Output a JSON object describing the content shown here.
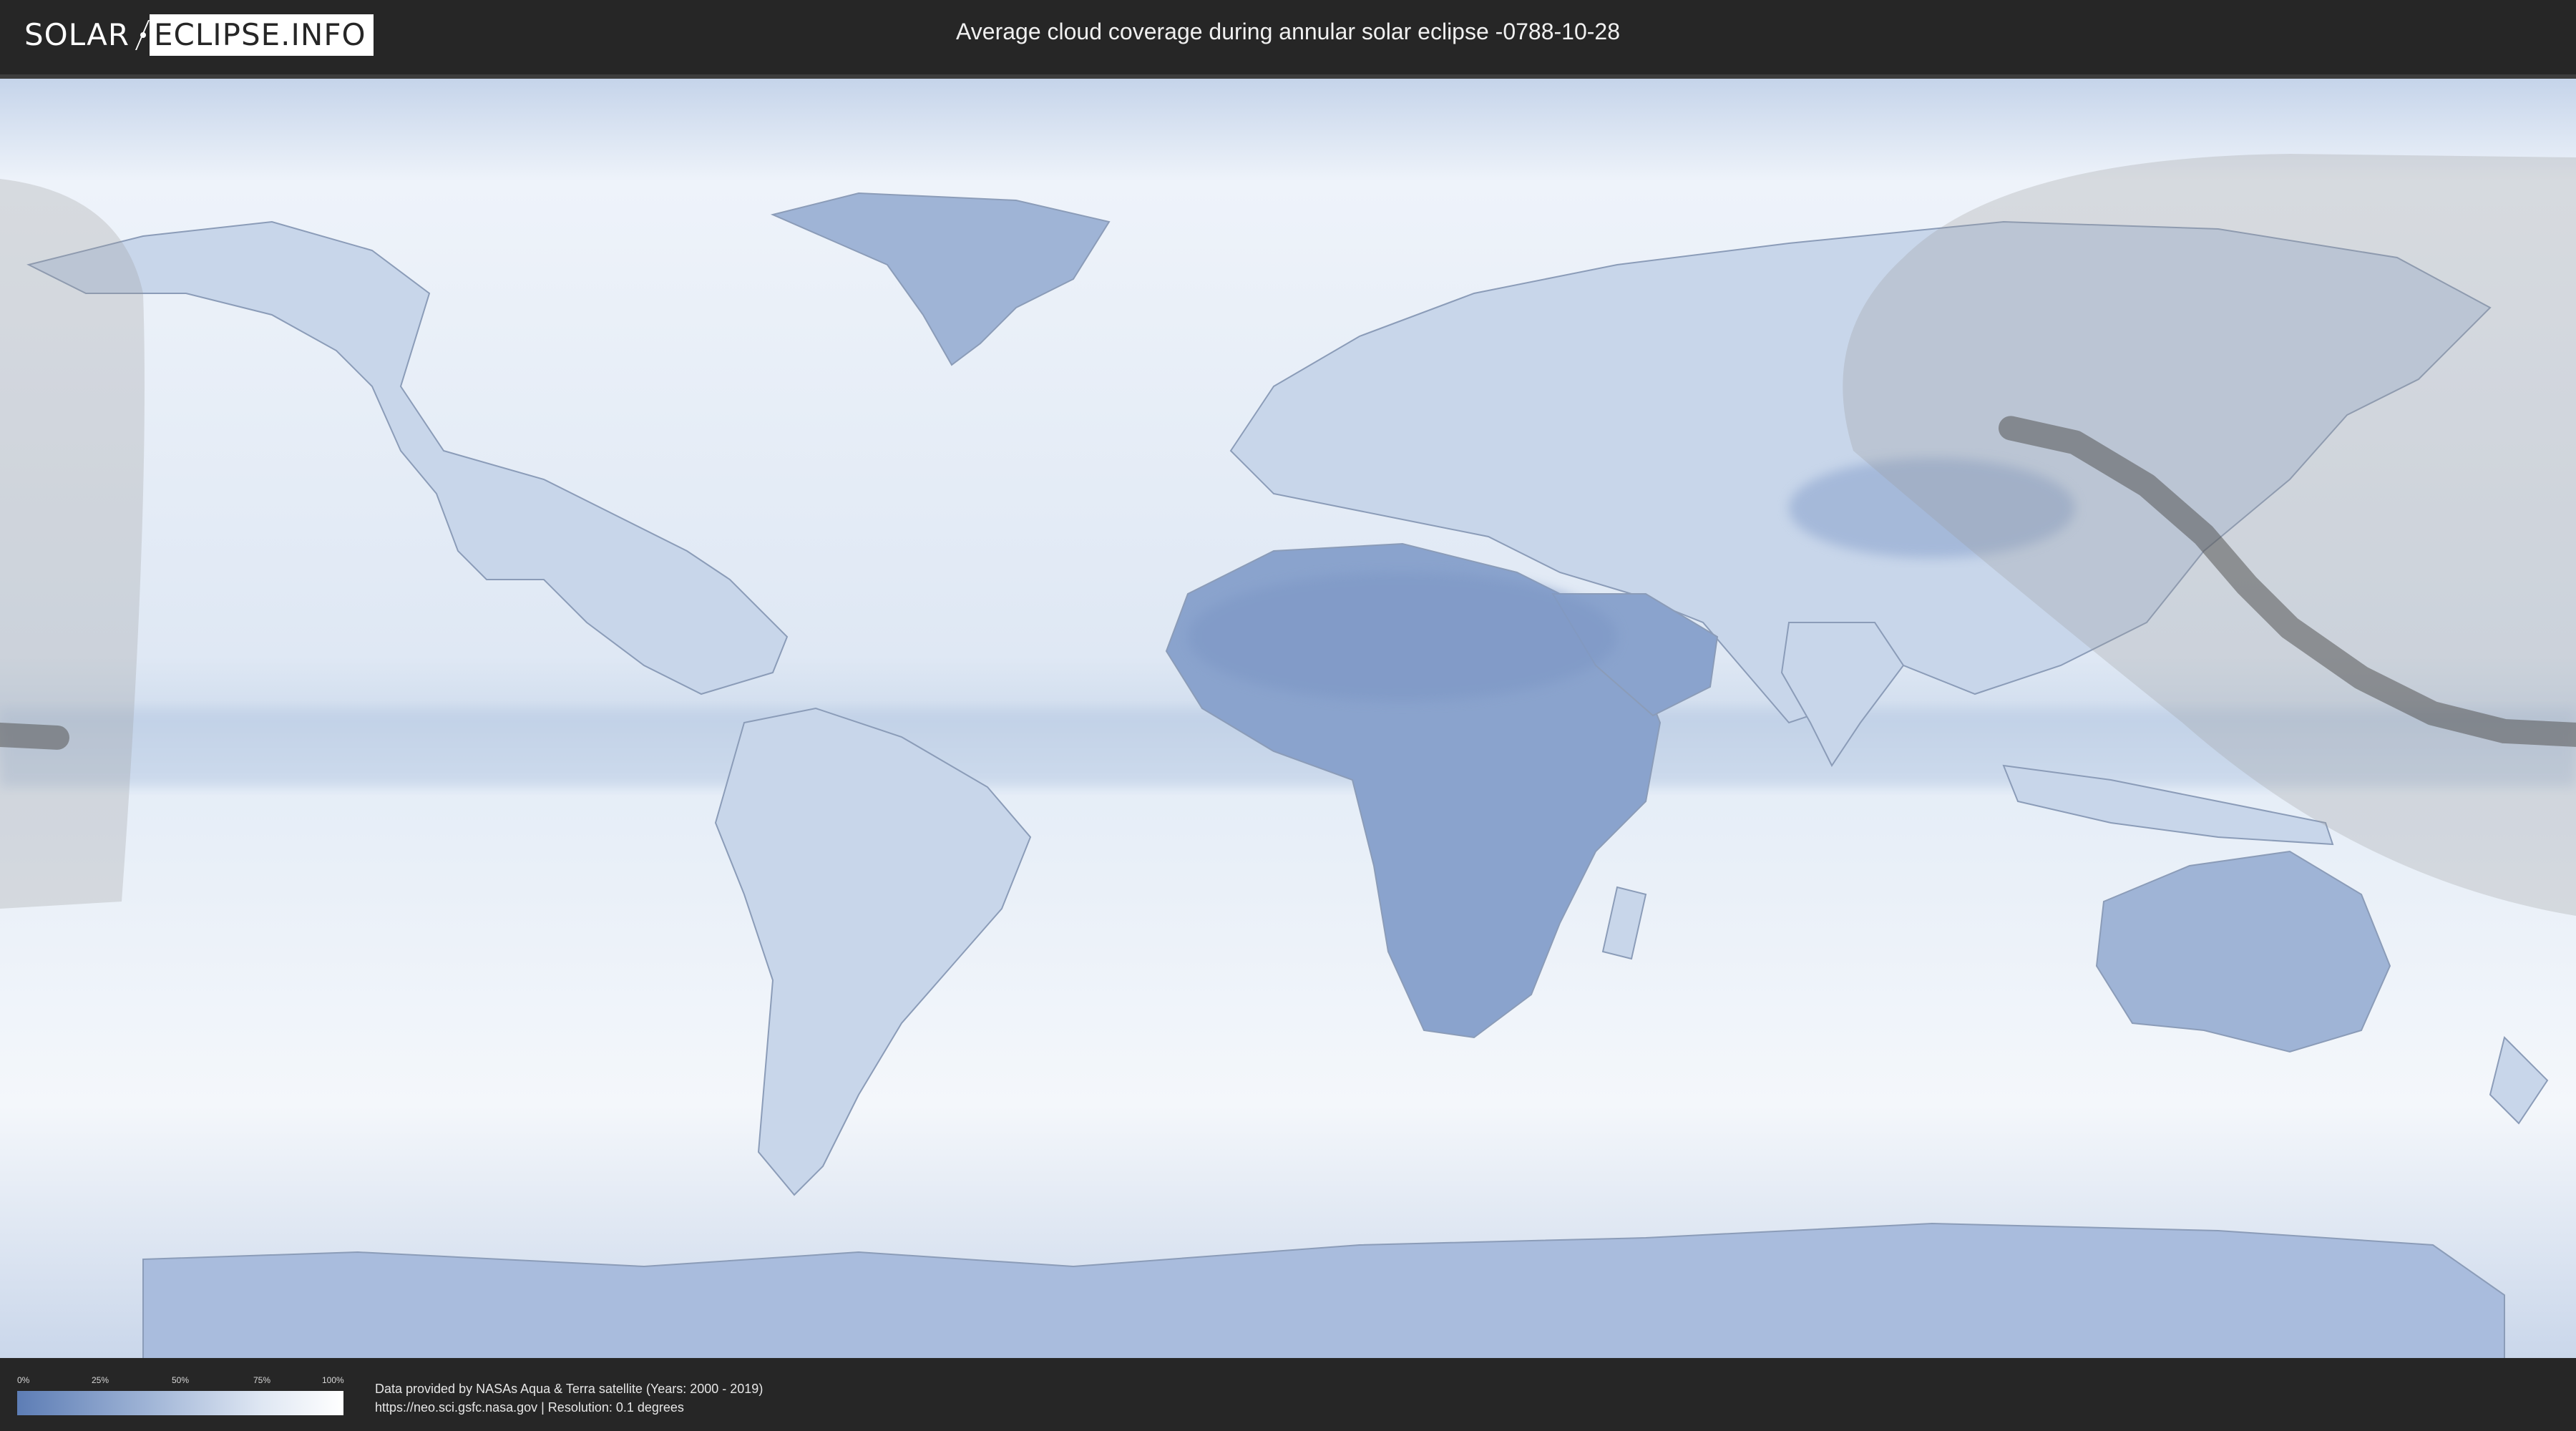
{
  "header": {
    "logo": {
      "part1": "SOLAR",
      "part2": "ECLIPSE.INFO"
    },
    "title": "Average cloud coverage during annular solar eclipse -0788-10-28"
  },
  "map": {
    "projection": "equirectangular",
    "ocean_color": "#e9eff7",
    "cloud_dark_color": "#6f8dbf",
    "land_outline_color": "#8b9cb8",
    "shadow_overlay_color": "#9a9a9a",
    "central_path_color": "#555555",
    "eclipse_central_path": [
      [
        -180,
        -2
      ],
      [
        -176,
        -2.2
      ],
      [
        -172,
        -2.4
      ]
    ],
    "eclipse_central_path_east": [
      [
        101,
        41
      ],
      [
        110,
        39
      ],
      [
        120,
        33
      ],
      [
        128,
        26
      ],
      [
        134,
        19
      ],
      [
        140,
        13
      ],
      [
        150,
        6
      ],
      [
        160,
        1
      ],
      [
        170,
        -1.5
      ],
      [
        180,
        -2
      ]
    ]
  },
  "legend": {
    "ticks": [
      "0%",
      "25%",
      "50%",
      "75%",
      "100%"
    ],
    "gradient": [
      "#5d7db5",
      "#ffffff"
    ]
  },
  "credits": {
    "line1": "Data provided by NASAs Aqua & Terra satellite (Years: 2000 - 2019)",
    "line2": "https://neo.sci.gsfc.nasa.gov | Resolution: 0.1 degrees"
  }
}
